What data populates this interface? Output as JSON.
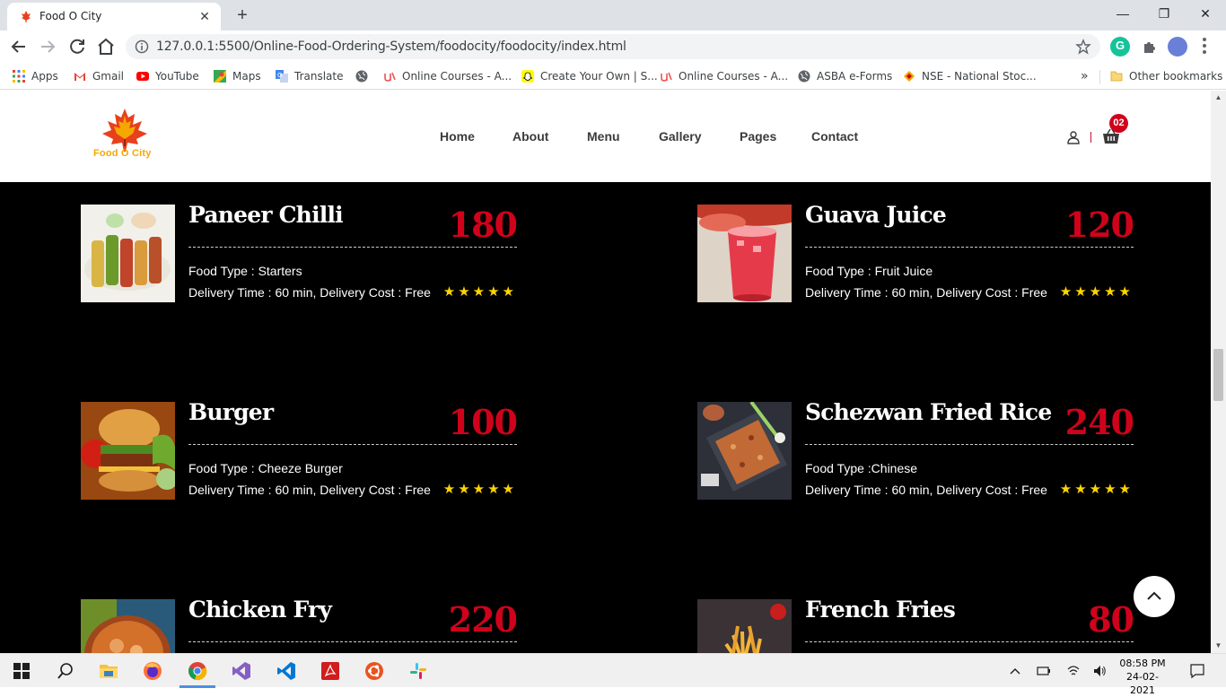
{
  "browser": {
    "tab_title": "Food O City",
    "url": "127.0.0.1:5500/Online-Food-Ordering-System/foodocity/foodocity/index.html",
    "bookmarks": [
      {
        "label": "Apps",
        "icon": "apps-grid-icon"
      },
      {
        "label": "Gmail",
        "icon": "gmail-icon"
      },
      {
        "label": "YouTube",
        "icon": "youtube-icon"
      },
      {
        "label": "Maps",
        "icon": "maps-icon"
      },
      {
        "label": "Translate",
        "icon": "translate-icon"
      },
      {
        "label": "",
        "icon": "globe-icon"
      },
      {
        "label": "Online Courses - A...",
        "icon": "udemy-icon"
      },
      {
        "label": "Create Your Own | S...",
        "icon": "snapchat-icon"
      },
      {
        "label": "Online Courses - A...",
        "icon": "udemy-icon"
      },
      {
        "label": "ASBA e-Forms",
        "icon": "globe-icon"
      },
      {
        "label": "NSE - National Stoc...",
        "icon": "nse-icon"
      }
    ],
    "more_bookmarks": "»",
    "other_bookmarks": "Other bookmarks"
  },
  "site": {
    "logo_text": "Food O City",
    "nav": [
      "Home",
      "About",
      "Menu",
      "Gallery",
      "Pages",
      "Contact"
    ],
    "cart_count": "02",
    "colors": {
      "accent": "#d0021b",
      "star": "#ffd500",
      "logo": "#f5a800"
    }
  },
  "menu_items": [
    {
      "name": "Paneer Chilli",
      "price": "180",
      "type": "Food Type : Starters",
      "delivery": "Delivery Time : 60 min, Delivery Cost : Free",
      "stars": "★★★★★",
      "rating": 5
    },
    {
      "name": "Guava Juice",
      "price": "120",
      "type": "Food Type : Fruit Juice",
      "delivery": "Delivery Time : 60 min, Delivery Cost : Free",
      "stars": "★★★★★",
      "rating": 5
    },
    {
      "name": "Burger",
      "price": "100",
      "type": "Food Type : Cheeze Burger",
      "delivery": "Delivery Time : 60 min, Delivery Cost : Free",
      "stars": "★★★★★",
      "rating": 5
    },
    {
      "name": "Schezwan Fried Rice",
      "price": "240",
      "type": "Food Type :Chinese",
      "delivery": "Delivery Time : 60 min, Delivery Cost : Free",
      "stars": "★★★★★",
      "rating": 5
    },
    {
      "name": "Chicken Fry",
      "price": "220"
    },
    {
      "name": "French Fries",
      "price": "80"
    }
  ],
  "taskbar": {
    "time": "08:58 PM",
    "date": "24-02-2021"
  }
}
